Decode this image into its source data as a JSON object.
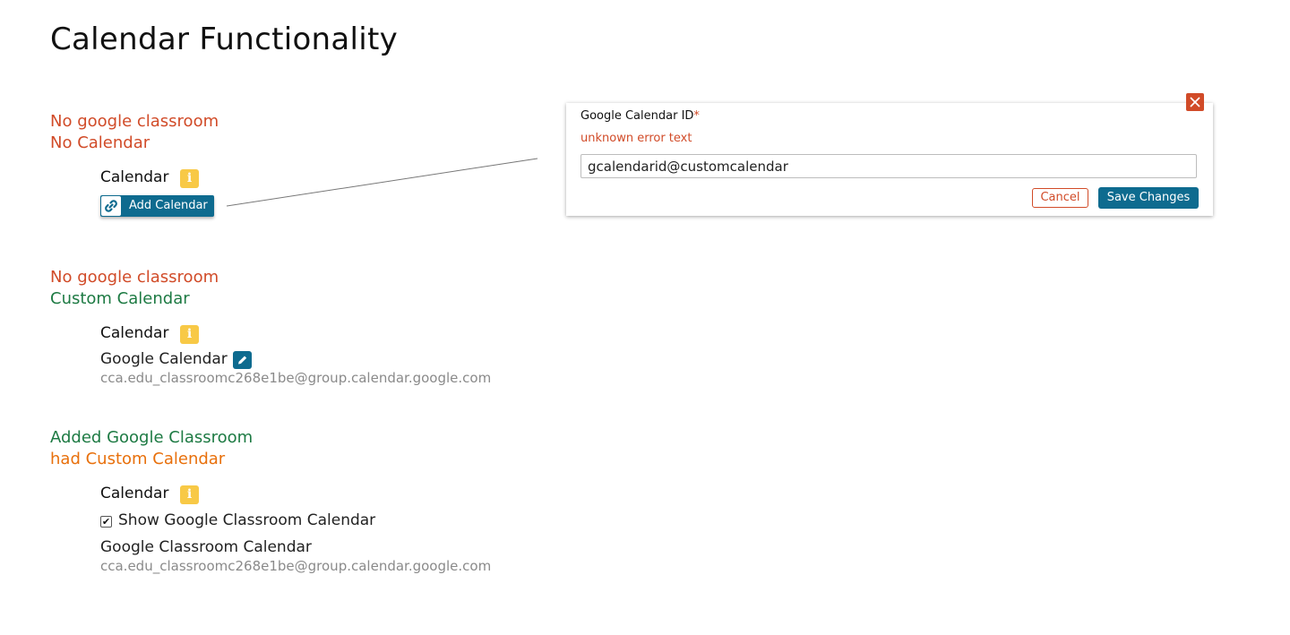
{
  "page": {
    "title": "Calendar Functionality"
  },
  "colors": {
    "red": "#d14b28",
    "green": "#1d7a43",
    "orange": "#e8700c",
    "teal": "#0e6b8f",
    "info_yellow": "#f8c946"
  },
  "scenario1": {
    "line1": "No google classroom",
    "line2": "No Calendar",
    "calendar_label": "Calendar",
    "info_icon_glyph": "i",
    "add_calendar_label": "Add Calendar"
  },
  "scenario2": {
    "line1": "No google classroom",
    "line2": "Custom Calendar",
    "calendar_label": "Calendar",
    "info_icon_glyph": "i",
    "google_calendar_label": "Google Calendar",
    "calendar_id": "cca.edu_classroomc268e1be@group.calendar.google.com"
  },
  "scenario3": {
    "line1": "Added Google Classroom",
    "line2": "had Custom Calendar",
    "calendar_label": "Calendar",
    "info_icon_glyph": "i",
    "checkbox_label": "Show Google Classroom Calendar",
    "checkbox_checked": true,
    "checkbox_glyph": "✔",
    "classroom_calendar_label": "Google Classroom Calendar",
    "calendar_id": "cca.edu_classroomc268e1be@group.calendar.google.com"
  },
  "modal": {
    "field_label": "Google Calendar ID",
    "required_marker": "*",
    "error_text": "unknown error text",
    "input_value": "gcalendarid@customcalendar",
    "cancel_label": "Cancel",
    "save_label": "Save Changes"
  }
}
